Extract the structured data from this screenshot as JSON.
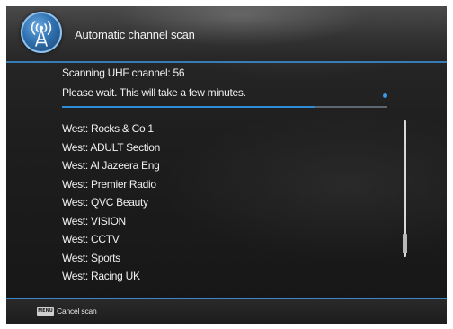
{
  "header": {
    "title": "Automatic channel scan",
    "icon": "antenna-broadcast-icon"
  },
  "scan": {
    "status": "Scanning UHF channel: 56",
    "message": "Please wait. This will take a few minutes.",
    "progress": 0.78
  },
  "channels": [
    "West: Rocks & Co 1",
    "West: ADULT Section",
    "West: Al Jazeera Eng",
    "West: Premier Radio",
    "West: QVC Beauty",
    "West: VISION",
    "West: CCTV",
    "West: Sports",
    "West: Racing UK"
  ],
  "footer": {
    "key_label": "MENU",
    "action_label": "Cancel scan"
  },
  "colors": {
    "accent": "#2f8ad8",
    "text": "#f0f0f0"
  }
}
